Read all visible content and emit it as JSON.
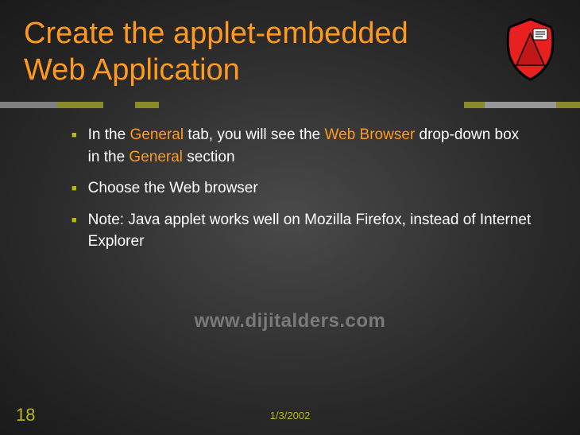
{
  "title": "Create the applet-embedded Web Application",
  "bullets": [
    {
      "prefix": "In the ",
      "hl1": "General",
      "mid1": " tab, you will see the ",
      "hl2": "Web Browser",
      "mid2": " drop-down box in the ",
      "hl3": "General",
      "suffix": " section"
    },
    {
      "text": "Choose the Web browser"
    },
    {
      "text": "Note: Java applet works well on Mozilla Firefox, instead of Internet Explorer"
    }
  ],
  "watermark": "www.dijitalders.com",
  "slide_number": "18",
  "date": "1/3/2002"
}
